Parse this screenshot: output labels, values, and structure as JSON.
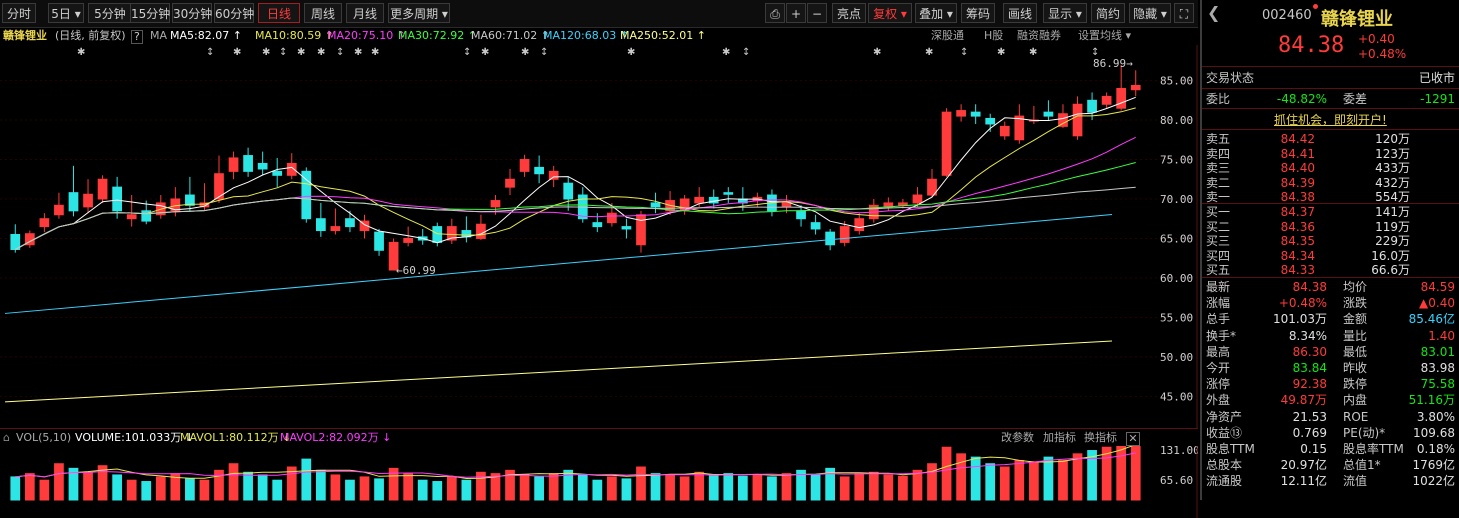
{
  "toolbar": {
    "periods": [
      "分时",
      "5日",
      "5分钟",
      "15分钟",
      "30分钟",
      "60分钟",
      "日线",
      "周线",
      "月线",
      "更多周期"
    ],
    "active_period": "日线",
    "actions": [
      "亮点",
      "复权",
      "叠加",
      "筹码",
      "画线",
      "显示",
      "简约",
      "隐藏"
    ],
    "active_action": "复权"
  },
  "ma_legend": {
    "name": "赣锋锂业",
    "mode": "(日线, 前复权)",
    "help": "?",
    "ma_label": "MA",
    "items": [
      {
        "label": "MA5:82.07",
        "arrow": "↑",
        "color": "#ffffff"
      },
      {
        "label": "MA10:80.59",
        "arrow": "↑",
        "color": "#e8e84d"
      },
      {
        "label": "MA20:75.10",
        "arrow": "↑",
        "color": "#ff3cff"
      },
      {
        "label": "MA30:72.92",
        "arrow": "↑",
        "color": "#3cff3c"
      },
      {
        "label": "MA60:71.02",
        "arrow": "↑",
        "color": "#c8c8c8"
      },
      {
        "label": "MA120:68.03",
        "arrow": "↑",
        "color": "#3cd2ff"
      },
      {
        "label": "MA250:52.01",
        "arrow": "↑",
        "color": "#ffff8c"
      }
    ],
    "right_links": [
      "深股通",
      "H股",
      "融资融券",
      "设置均线"
    ]
  },
  "annotations": {
    "high": "86.99",
    "low": "60.99"
  },
  "y_axis": [
    "85.00",
    "80.00",
    "75.00",
    "70.00",
    "65.00",
    "60.00",
    "55.00",
    "50.00",
    "45.00"
  ],
  "volume_legend": {
    "title": "VOL(5,10)",
    "volume": "VOLUME:101.033万",
    "mavol1": "MAVOL1:80.112万",
    "mavol2": "MAVOL2:82.092万",
    "links": [
      "改参数",
      "加指标",
      "换指标"
    ],
    "y_axis": [
      "131.00",
      "65.60"
    ]
  },
  "quote": {
    "code": "002460",
    "name": "赣锋锂业",
    "price": "84.38",
    "change": "+0.40",
    "change_pct": "+0.48%",
    "status_label": "交易状态",
    "status": "已收市",
    "weibi_label": "委比",
    "weibi": "-48.82%",
    "weicha_label": "委差",
    "weicha": "-1291",
    "promo": "抓住机会，即刻开户!",
    "asks": [
      {
        "label": "卖五",
        "price": "84.42",
        "vol": "120万"
      },
      {
        "label": "卖四",
        "price": "84.41",
        "vol": "123万"
      },
      {
        "label": "卖三",
        "price": "84.40",
        "vol": "433万"
      },
      {
        "label": "卖二",
        "price": "84.39",
        "vol": "432万"
      },
      {
        "label": "卖一",
        "price": "84.38",
        "vol": "554万"
      }
    ],
    "bids": [
      {
        "label": "买一",
        "price": "84.37",
        "vol": "141万"
      },
      {
        "label": "买二",
        "price": "84.36",
        "vol": "119万"
      },
      {
        "label": "买三",
        "price": "84.35",
        "vol": "229万"
      },
      {
        "label": "买四",
        "price": "84.34",
        "vol": "16.0万"
      },
      {
        "label": "买五",
        "price": "84.33",
        "vol": "66.6万"
      }
    ],
    "stats": [
      {
        "l1": "最新",
        "v1": "84.38",
        "c1": "red",
        "l2": "均价",
        "v2": "84.59",
        "c2": "red"
      },
      {
        "l1": "涨幅",
        "v1": "+0.48%",
        "c1": "red",
        "l2": "涨跌",
        "v2": "▲0.40",
        "c2": "red"
      },
      {
        "l1": "总手",
        "v1": "101.03万",
        "c1": "white",
        "l2": "金额",
        "v2": "85.46亿",
        "c2": "cyan"
      },
      {
        "l1": "换手*",
        "v1": "8.34%",
        "c1": "white",
        "l2": "量比",
        "v2": "1.40",
        "c2": "red"
      },
      {
        "l1": "最高",
        "v1": "86.30",
        "c1": "red",
        "l2": "最低",
        "v2": "83.01",
        "c2": "green"
      },
      {
        "l1": "今开",
        "v1": "83.84",
        "c1": "green",
        "l2": "昨收",
        "v2": "83.98",
        "c2": "white"
      },
      {
        "l1": "涨停",
        "v1": "92.38",
        "c1": "red",
        "l2": "跌停",
        "v2": "75.58",
        "c2": "green"
      },
      {
        "l1": "外盘",
        "v1": "49.87万",
        "c1": "red",
        "l2": "内盘",
        "v2": "51.16万",
        "c2": "green"
      },
      {
        "l1": "净资产",
        "v1": "21.53",
        "c1": "white",
        "l2": "ROE",
        "v2": "3.80%",
        "c2": "white"
      },
      {
        "l1": "收益⑬",
        "v1": "0.769",
        "c1": "white",
        "l2": "PE(动)*",
        "v2": "109.68",
        "c2": "white"
      },
      {
        "l1": "股息TTM",
        "v1": "0.15",
        "c1": "white",
        "l2": "股息率TTM",
        "v2": "0.18%",
        "c2": "white"
      },
      {
        "l1": "总股本",
        "v1": "20.97亿",
        "c1": "white",
        "l2": "总值1*",
        "v2": "1769亿",
        "c2": "white"
      },
      {
        "l1": "流通股",
        "v1": "12.11亿",
        "c1": "white",
        "l2": "流值",
        "v2": "1022亿",
        "c2": "white"
      }
    ]
  },
  "colors": {
    "up": "#ff3b3b",
    "down": "#2ce6e6",
    "grid": "#3a0000"
  },
  "chart_data": {
    "type": "candlestick",
    "ylim": [
      42,
      89
    ],
    "candles": [
      [
        65.5,
        63.6,
        66.8,
        63.2
      ],
      [
        64.2,
        65.6,
        66.0,
        63.8
      ],
      [
        66.5,
        67.5,
        68.2,
        65.8
      ],
      [
        68.0,
        69.2,
        70.8,
        67.5
      ],
      [
        70.8,
        68.5,
        74.2,
        67.8
      ],
      [
        69.0,
        70.6,
        72.5,
        68.2
      ],
      [
        70.0,
        72.5,
        73.0,
        69.5
      ],
      [
        71.5,
        68.5,
        72.8,
        67.5
      ],
      [
        67.5,
        68.0,
        70.5,
        66.5
      ],
      [
        68.5,
        67.2,
        69.8,
        66.8
      ],
      [
        68.0,
        69.5,
        70.5,
        67.5
      ],
      [
        68.5,
        70.0,
        71.5,
        67.8
      ],
      [
        70.5,
        69.2,
        72.8,
        68.5
      ],
      [
        69.0,
        69.5,
        72.0,
        68.5
      ],
      [
        70.0,
        73.2,
        75.5,
        69.5
      ],
      [
        73.5,
        75.2,
        76.0,
        72.5
      ],
      [
        75.5,
        73.5,
        76.5,
        72.8
      ],
      [
        74.5,
        73.8,
        76.0,
        73.0
      ],
      [
        73.5,
        73.0,
        75.2,
        71.5
      ],
      [
        73.0,
        74.5,
        75.8,
        72.5
      ],
      [
        73.5,
        67.5,
        74.0,
        67.0
      ],
      [
        67.5,
        66.0,
        69.5,
        65.2
      ],
      [
        66.0,
        66.5,
        68.8,
        65.5
      ],
      [
        67.5,
        66.5,
        68.5,
        65.8
      ],
      [
        66.0,
        67.2,
        68.0,
        65.0
      ],
      [
        65.8,
        63.5,
        66.2,
        62.8
      ],
      [
        61.0,
        64.5,
        65.0,
        60.99
      ],
      [
        64.5,
        65.0,
        66.5,
        64.0
      ],
      [
        65.2,
        64.8,
        66.2,
        64.2
      ],
      [
        66.5,
        64.5,
        67.0,
        64.0
      ],
      [
        64.8,
        66.5,
        67.5,
        64.3
      ],
      [
        66.0,
        65.2,
        67.8,
        64.5
      ],
      [
        65.0,
        66.8,
        68.0,
        64.8
      ],
      [
        69.0,
        69.8,
        70.5,
        68.0
      ],
      [
        71.5,
        72.5,
        73.8,
        70.5
      ],
      [
        73.5,
        75.0,
        75.6,
        72.8
      ],
      [
        74.0,
        73.2,
        75.5,
        72.0
      ],
      [
        72.5,
        73.5,
        74.2,
        71.5
      ],
      [
        72.0,
        70.0,
        72.8,
        68.5
      ],
      [
        70.5,
        67.5,
        71.5,
        67.0
      ],
      [
        67.0,
        66.5,
        68.2,
        65.8
      ],
      [
        67.0,
        68.2,
        69.5,
        66.5
      ],
      [
        66.5,
        66.2,
        67.5,
        65.0
      ],
      [
        64.2,
        68.0,
        68.5,
        63.2
      ],
      [
        69.5,
        69.0,
        70.8,
        68.2
      ],
      [
        68.5,
        69.8,
        71.0,
        68.0
      ],
      [
        68.5,
        70.0,
        70.5,
        68.0
      ],
      [
        69.5,
        70.2,
        71.5,
        69.0
      ],
      [
        70.2,
        69.5,
        71.2,
        68.8
      ],
      [
        70.8,
        70.6,
        71.5,
        69.5
      ],
      [
        70.0,
        69.5,
        71.5,
        68.5
      ],
      [
        69.8,
        70.2,
        70.8,
        69.0
      ],
      [
        70.5,
        68.5,
        71.2,
        67.8
      ],
      [
        69.0,
        69.5,
        70.5,
        68.2
      ],
      [
        68.5,
        67.5,
        69.2,
        66.5
      ],
      [
        67.0,
        66.2,
        68.0,
        65.5
      ],
      [
        65.8,
        64.2,
        66.2,
        63.5
      ],
      [
        64.5,
        66.5,
        67.2,
        64.0
      ],
      [
        66.0,
        67.5,
        68.2,
        65.5
      ],
      [
        67.5,
        69.2,
        70.0,
        67.0
      ],
      [
        69.0,
        69.5,
        70.2,
        68.5
      ],
      [
        69.2,
        69.5,
        70.0,
        68.8
      ],
      [
        69.5,
        70.5,
        71.5,
        69.0
      ],
      [
        70.5,
        72.5,
        73.8,
        70.2
      ],
      [
        73.0,
        81.0,
        81.5,
        72.8
      ],
      [
        80.5,
        81.2,
        82.0,
        79.8
      ],
      [
        81.0,
        80.5,
        82.0,
        79.5
      ],
      [
        80.2,
        79.5,
        80.8,
        78.5
      ],
      [
        78.0,
        79.2,
        79.8,
        77.5
      ],
      [
        77.5,
        80.5,
        82.0,
        77.0
      ],
      [
        80.0,
        80.0,
        81.8,
        79.5
      ],
      [
        81.0,
        80.5,
        82.5,
        80.0
      ],
      [
        79.2,
        80.8,
        82.0,
        79.0
      ],
      [
        78.0,
        82.0,
        83.0,
        77.5
      ],
      [
        82.5,
        81.0,
        83.5,
        80.0
      ],
      [
        82.0,
        83.0,
        83.5,
        81.5
      ],
      [
        81.5,
        84.0,
        86.99,
        81.2
      ],
      [
        83.84,
        84.38,
        86.3,
        83.01
      ]
    ],
    "volume": [
      35,
      40,
      30,
      55,
      48,
      42,
      52,
      38,
      30,
      28,
      35,
      40,
      32,
      30,
      45,
      55,
      42,
      38,
      30,
      50,
      62,
      45,
      38,
      30,
      35,
      32,
      48,
      40,
      30,
      28,
      35,
      30,
      42,
      40,
      45,
      38,
      35,
      40,
      45,
      38,
      30,
      35,
      32,
      50,
      40,
      38,
      35,
      42,
      38,
      40,
      36,
      38,
      35,
      40,
      45,
      38,
      48,
      35,
      40,
      42,
      38,
      36,
      45,
      55,
      80,
      70,
      65,
      55,
      50,
      60,
      58,
      65,
      60,
      70,
      75,
      80,
      95,
      101
    ]
  }
}
